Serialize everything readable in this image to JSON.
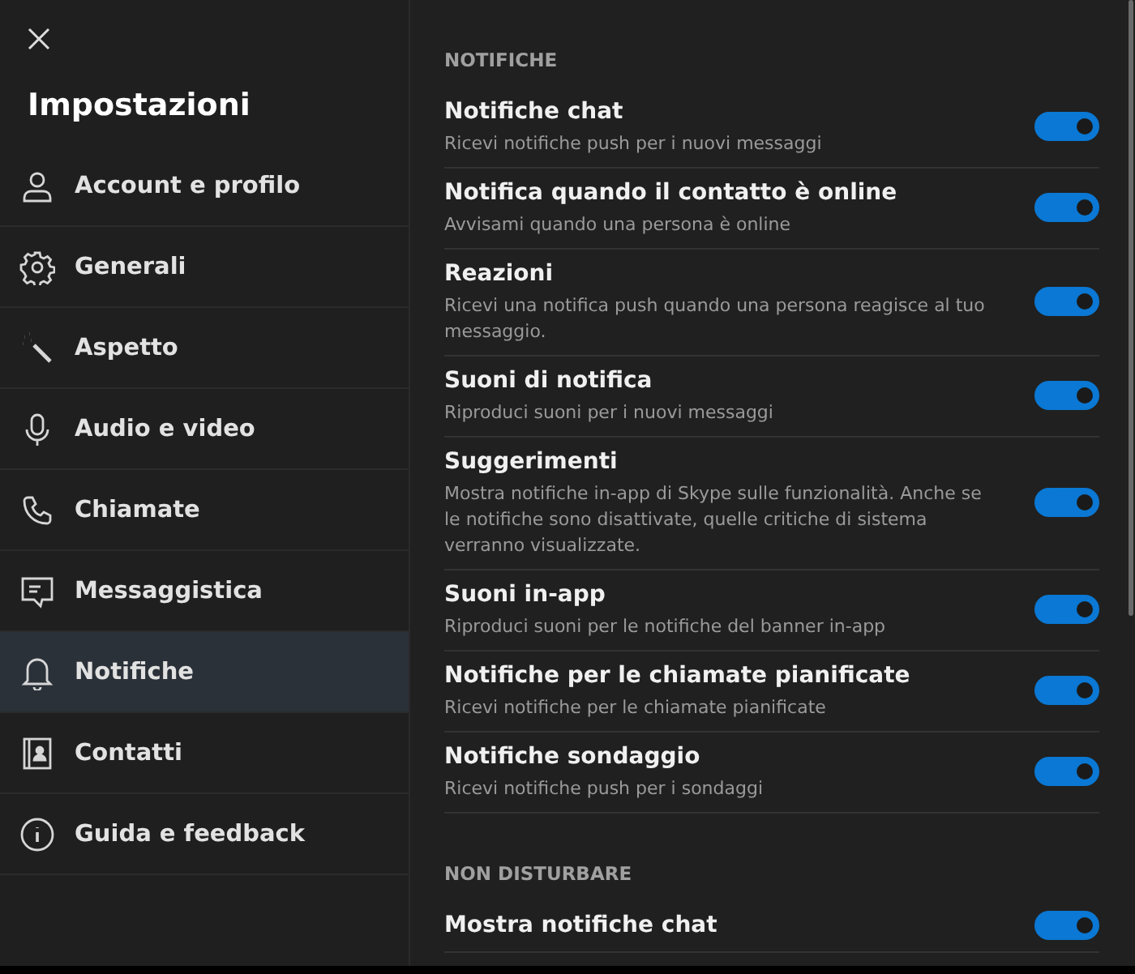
{
  "sidebar": {
    "title": "Impostazioni",
    "items": [
      {
        "label": "Account e profilo",
        "selected": false
      },
      {
        "label": "Generali",
        "selected": false
      },
      {
        "label": "Aspetto",
        "selected": false
      },
      {
        "label": "Audio e video",
        "selected": false
      },
      {
        "label": "Chiamate",
        "selected": false
      },
      {
        "label": "Messaggistica",
        "selected": false
      },
      {
        "label": "Notifiche",
        "selected": true
      },
      {
        "label": "Contatti",
        "selected": false
      },
      {
        "label": "Guida e feedback",
        "selected": false
      }
    ]
  },
  "sections": [
    {
      "heading": "NOTIFICHE",
      "settings": [
        {
          "title": "Notifiche chat",
          "description": "Ricevi notifiche push per i nuovi messaggi",
          "on": true
        },
        {
          "title": "Notifica quando il contatto è online",
          "description": "Avvisami quando una persona è online",
          "on": true
        },
        {
          "title": "Reazioni",
          "description": "Ricevi una notifica push quando una persona reagisce al tuo messaggio.",
          "on": true
        },
        {
          "title": "Suoni di notifica",
          "description": "Riproduci suoni per i nuovi messaggi",
          "on": true
        },
        {
          "title": "Suggerimenti",
          "description": "Mostra notifiche in-app di Skype sulle funzionalità. Anche se le notifiche sono disattivate, quelle critiche di sistema verranno visualizzate.",
          "on": true
        },
        {
          "title": "Suoni in-app",
          "description": "Riproduci suoni per le notifiche del banner in-app",
          "on": true
        },
        {
          "title": "Notifiche per le chiamate pianificate",
          "description": "Ricevi notifiche per le chiamate pianificate",
          "on": true
        },
        {
          "title": "Notifiche sondaggio",
          "description": "Ricevi notifiche push per i sondaggi",
          "on": true
        }
      ]
    },
    {
      "heading": "NON DISTURBARE",
      "settings": [
        {
          "title": "Mostra notifiche chat",
          "on": true
        }
      ]
    }
  ]
}
